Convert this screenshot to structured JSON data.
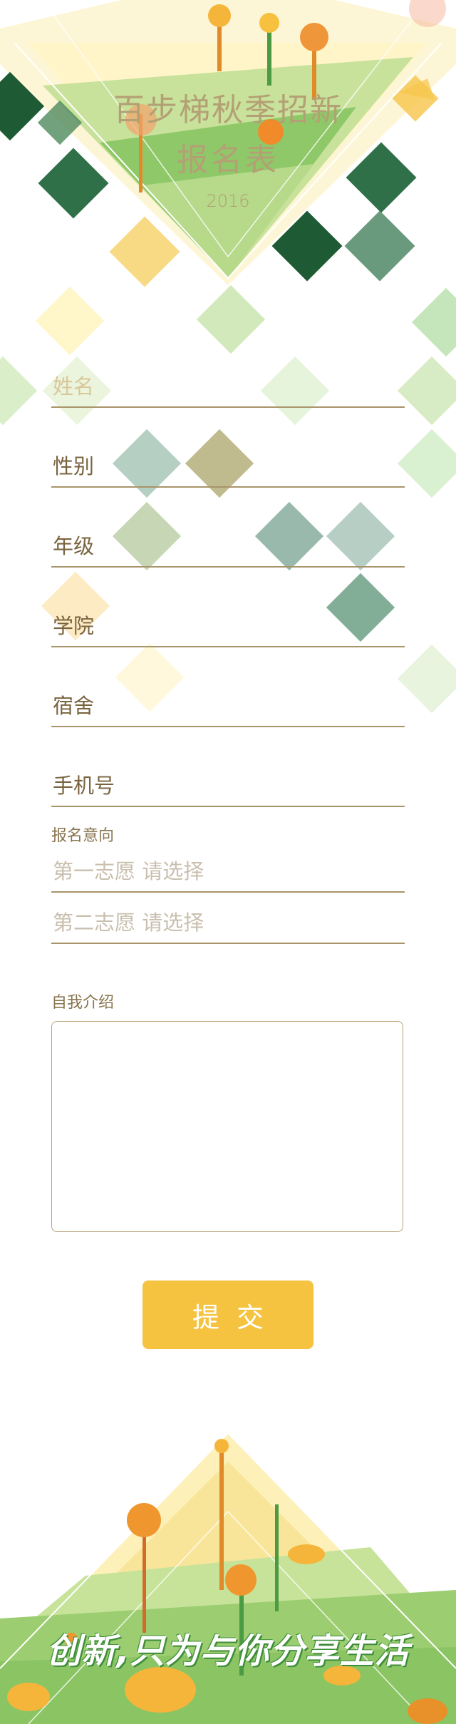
{
  "header": {
    "title_line1": "百步梯秋季招新",
    "title_line2": "报名表",
    "year": "2016"
  },
  "form": {
    "name_placeholder": "姓名",
    "gender_placeholder": "性别",
    "grade_placeholder": "年级",
    "college_placeholder": "学院",
    "dorm_placeholder": "宿舍",
    "phone_placeholder": "手机号",
    "intention_label": "报名意向",
    "first_choice_placeholder": "第一志愿 请选择",
    "second_choice_placeholder": "第二志愿 请选择",
    "intro_label": "自我介绍",
    "submit_label": "提交"
  },
  "footer": {
    "slogan": "创新,只为与你分享生活"
  },
  "colors": {
    "accent_gold": "#f5c33f",
    "text_brown": "#7a6440",
    "line_brown": "#a8946a",
    "dark_green": "#1e5a33",
    "light_green": "#8cc66a"
  }
}
